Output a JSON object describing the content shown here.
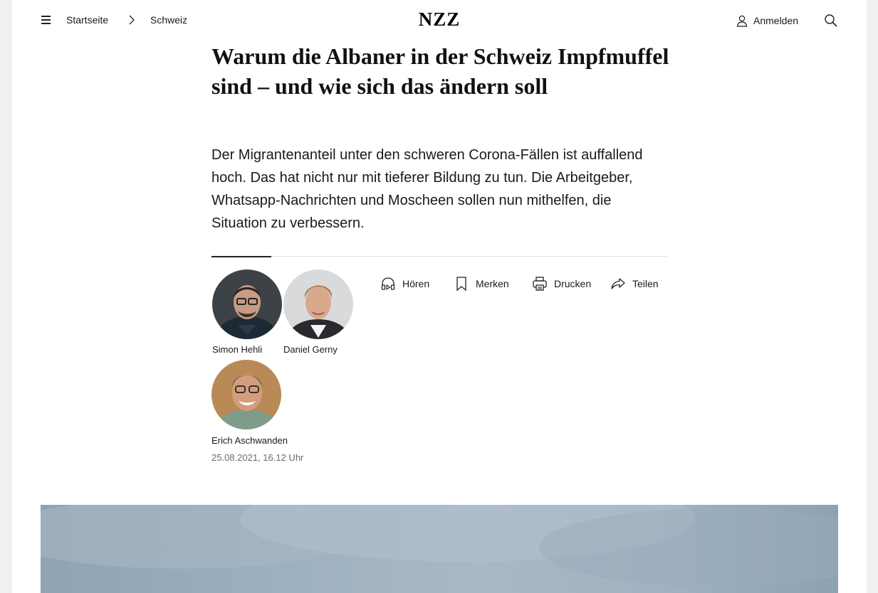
{
  "header": {
    "breadcrumb_home": "Startseite",
    "breadcrumb_current": "Schweiz",
    "logo": "NZZ",
    "login_label": "Anmelden"
  },
  "article": {
    "title": "Warum die Albaner in der Schweiz Impfmuffel sind – und wie sich das ändern soll",
    "lead": "Der Migrantenanteil unter den schweren Corona-Fällen ist auffallend hoch. Das hat nicht nur mit tieferer Bildung zu tun. Die Arbeitgeber, Whatsapp-Nachrichten und Moscheen sollen nun mithelfen, die Situation zu verbessern.",
    "authors": [
      {
        "name": "Simon Hehli"
      },
      {
        "name": "Daniel Gerny"
      },
      {
        "name": "Erich Aschwanden"
      }
    ],
    "date": "25.08.2021, 16.12 Uhr"
  },
  "actions": {
    "listen": "Hören",
    "save": "Merken",
    "print": "Drucken",
    "share": "Teilen"
  },
  "icons": [
    "menu-icon",
    "chevron-right-icon",
    "user-icon",
    "search-icon",
    "headphones-icon",
    "bookmark-icon",
    "printer-icon",
    "share-icon"
  ],
  "colors": {
    "text": "#1a1a1a",
    "muted": "#6a6a6a",
    "background": "#ffffff"
  }
}
